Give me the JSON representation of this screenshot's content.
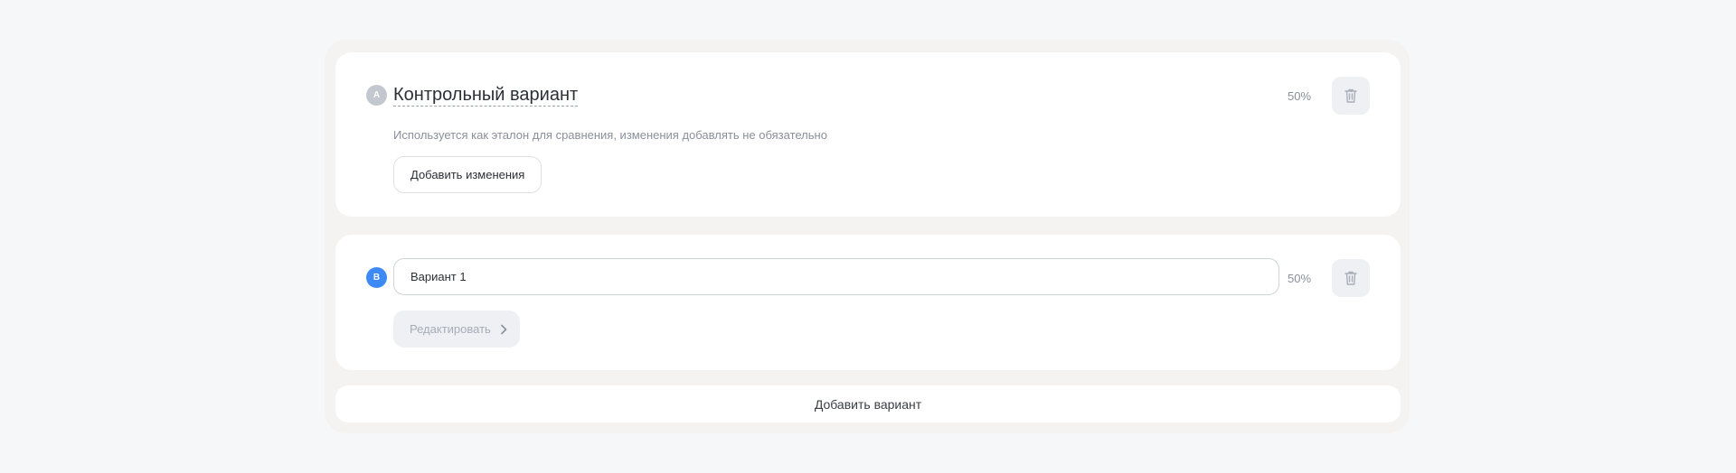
{
  "variant_a": {
    "badge": "A",
    "title": "Контрольный вариант",
    "description": "Используется как эталон для сравнения, изменения добавлять не обязательно",
    "add_changes_label": "Добавить изменения",
    "percent": "50%",
    "badge_color": "#c2c7d0",
    "delete_icon": "trash-icon"
  },
  "variant_b": {
    "badge": "B",
    "name_value": "Вариант 1",
    "edit_label": "Редактировать",
    "percent": "50%",
    "badge_color": "#3d8af7",
    "delete_icon": "trash-icon",
    "edit_icon": "chevron-right-icon"
  },
  "add_variant_label": "Добавить вариант"
}
